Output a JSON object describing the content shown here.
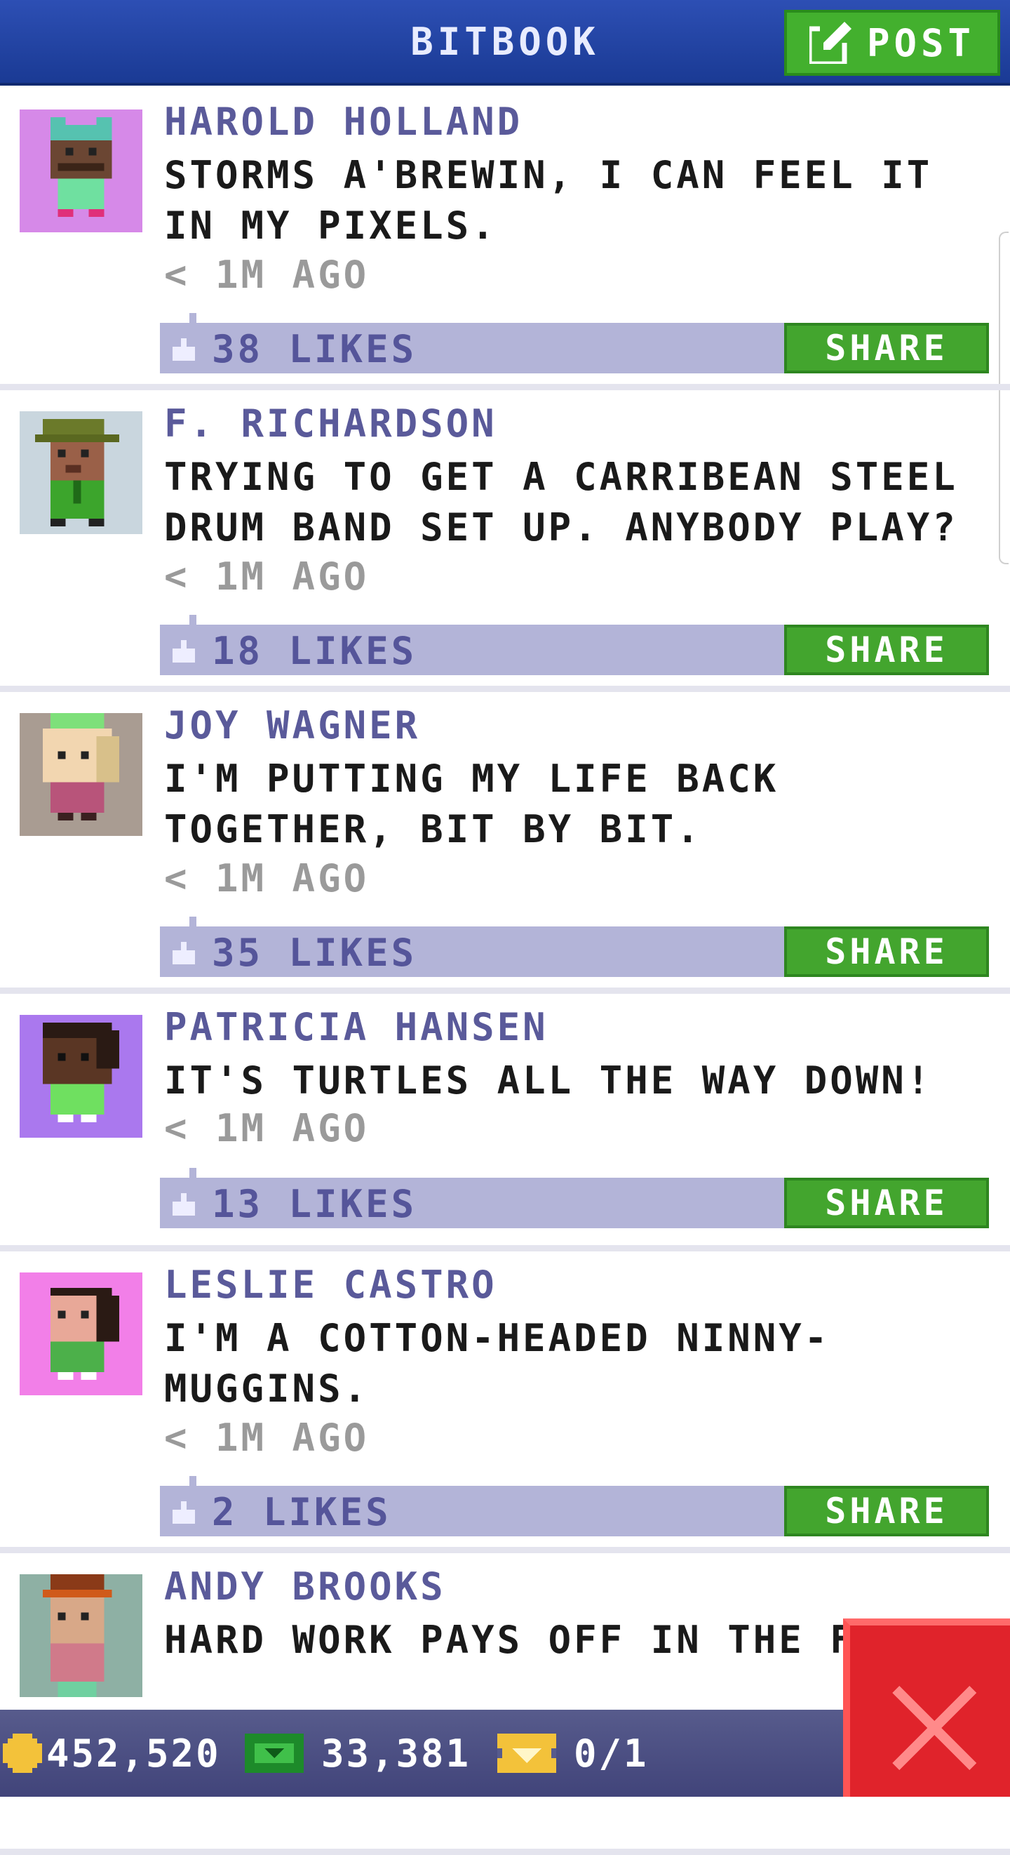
{
  "header": {
    "title": "BITBOOK",
    "post_label": "POST"
  },
  "posts": [
    {
      "author": "HAROLD HOLLAND",
      "text": "STORMS A'BREWIN, I CAN FEEL IT IN MY PIXELS.",
      "time": "< 1M AGO",
      "likes": "38 LIKES",
      "share": "SHARE",
      "avatar_bg": "#d689e8"
    },
    {
      "author": "F. RICHARDSON",
      "text": "TRYING TO GET A CARRIBEAN STEEL DRUM BAND SET UP. ANYBODY PLAY?",
      "time": "< 1M AGO",
      "likes": "18 LIKES",
      "share": "SHARE",
      "avatar_bg": "#c9d6de"
    },
    {
      "author": "JOY WAGNER",
      "text": "I'M PUTTING MY LIFE BACK TOGETHER, BIT BY BIT.",
      "time": "< 1M AGO",
      "likes": "35 LIKES",
      "share": "SHARE",
      "avatar_bg": "#a99c92"
    },
    {
      "author": "PATRICIA HANSEN",
      "text": "IT'S TURTLES ALL THE WAY DOWN!",
      "time": "< 1M AGO",
      "likes": "13 LIKES",
      "share": "SHARE",
      "avatar_bg": "#aa78ee"
    },
    {
      "author": "LESLIE CASTRO",
      "text": "I'M A COTTON-HEADED NINNY-MUGGINS.",
      "time": "< 1M AGO",
      "likes": "2 LIKES",
      "share": "SHARE",
      "avatar_bg": "#f27fe8"
    },
    {
      "author": "ANDY BROOKS",
      "text": "HARD WORK PAYS OFF IN THE FU",
      "avatar_bg": "#8eb0a4"
    }
  ],
  "bottom_bar": {
    "coins": "452,520",
    "bux": "33,381",
    "tickets": "0/1"
  }
}
